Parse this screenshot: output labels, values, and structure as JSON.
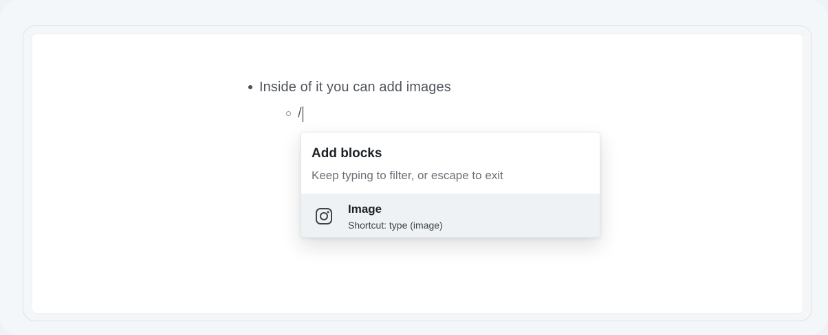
{
  "document": {
    "lines": [
      {
        "text": "Inside of it you can add images",
        "level": 1
      },
      {
        "text": "/",
        "level": 2
      }
    ]
  },
  "menu": {
    "title": "Add blocks",
    "subtitle": "Keep typing to filter, or escape to exit",
    "items": [
      {
        "label": "Image",
        "shortcut": "Shortcut: type (image)",
        "icon": "instagram-image-icon"
      }
    ]
  },
  "colors": {
    "background": "#eef3f8",
    "editor": "#ffffff",
    "highlight": "#eef2f4",
    "text": "#1d2126",
    "muted": "#6b7178"
  }
}
